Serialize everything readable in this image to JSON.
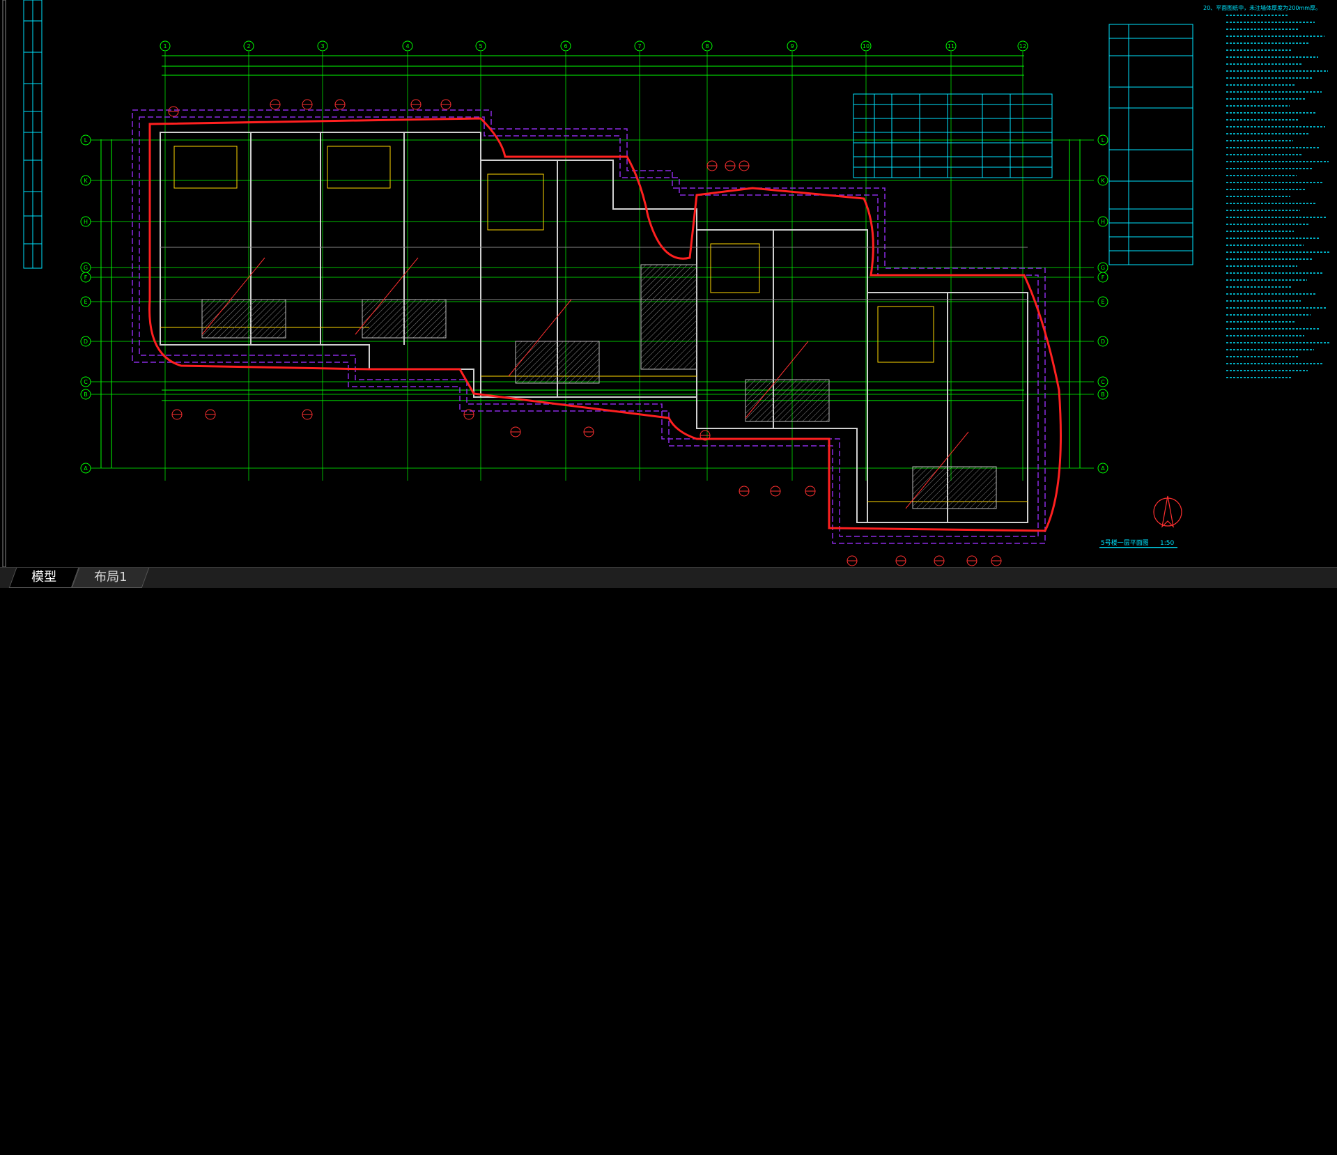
{
  "tabs": [
    {
      "label": "模型",
      "active": true
    },
    {
      "label": "布局1",
      "active": false
    }
  ],
  "drawing": {
    "column_grid_labels": [
      "1",
      "2",
      "3",
      "4",
      "5",
      "6",
      "7",
      "8",
      "9",
      "10",
      "11",
      "12"
    ],
    "row_grid_labels": [
      "L",
      "K",
      "H",
      "G",
      "F",
      "E",
      "D",
      "C",
      "B",
      "A"
    ],
    "plan_title": "5号楼一层平面图",
    "plan_scale": "1:50",
    "notes_heading": "20、平面图纸中，未注墙体厚度为200mm厚。",
    "colors": {
      "background": "#000000",
      "axis": "#00ff00",
      "wall": "#ffffff",
      "boundary": "#ff2020",
      "dashed_outline": "#8a2be2",
      "tables": "#00e5ff",
      "annotations": "#ffff00"
    }
  }
}
